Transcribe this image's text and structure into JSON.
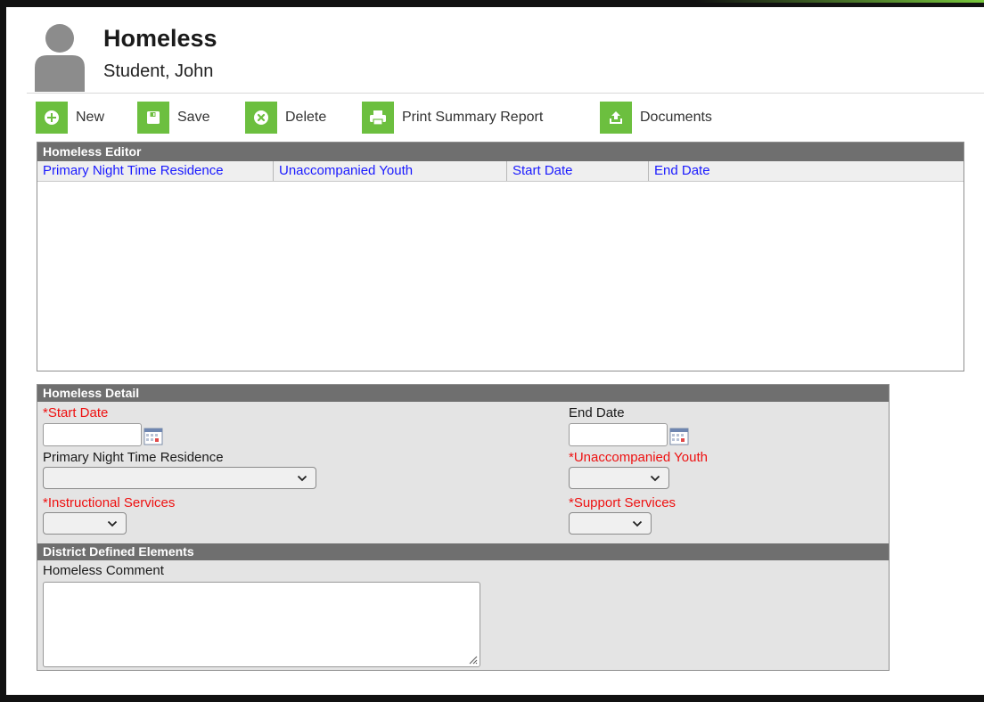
{
  "header": {
    "title": "Homeless",
    "subtitle": "Student, John"
  },
  "toolbar": {
    "new_label": "New",
    "save_label": "Save",
    "delete_label": "Delete",
    "print_label": "Print Summary Report",
    "documents_label": "Documents"
  },
  "editor": {
    "title": "Homeless Editor",
    "columns": [
      "Primary Night Time Residence",
      "Unaccompanied Youth",
      "Start Date",
      "End Date"
    ],
    "rows": []
  },
  "detail": {
    "title": "Homeless Detail",
    "start_date_label": "*Start Date",
    "start_date_value": "",
    "end_date_label": "End Date",
    "end_date_value": "",
    "residence_label": "Primary Night Time Residence",
    "residence_value": "",
    "unaccompanied_label": "*Unaccompanied Youth",
    "unaccompanied_value": "",
    "instructional_label": "*Instructional Services",
    "instructional_value": "",
    "support_label": "*Support Services",
    "support_value": ""
  },
  "district": {
    "title": "District Defined Elements",
    "comment_label": "Homeless Comment",
    "comment_value": ""
  },
  "colors": {
    "accent_green": "#6cbf3f",
    "section_gray": "#6f6f6f",
    "required_red": "#ee1111",
    "link_blue": "#1a1aff"
  }
}
